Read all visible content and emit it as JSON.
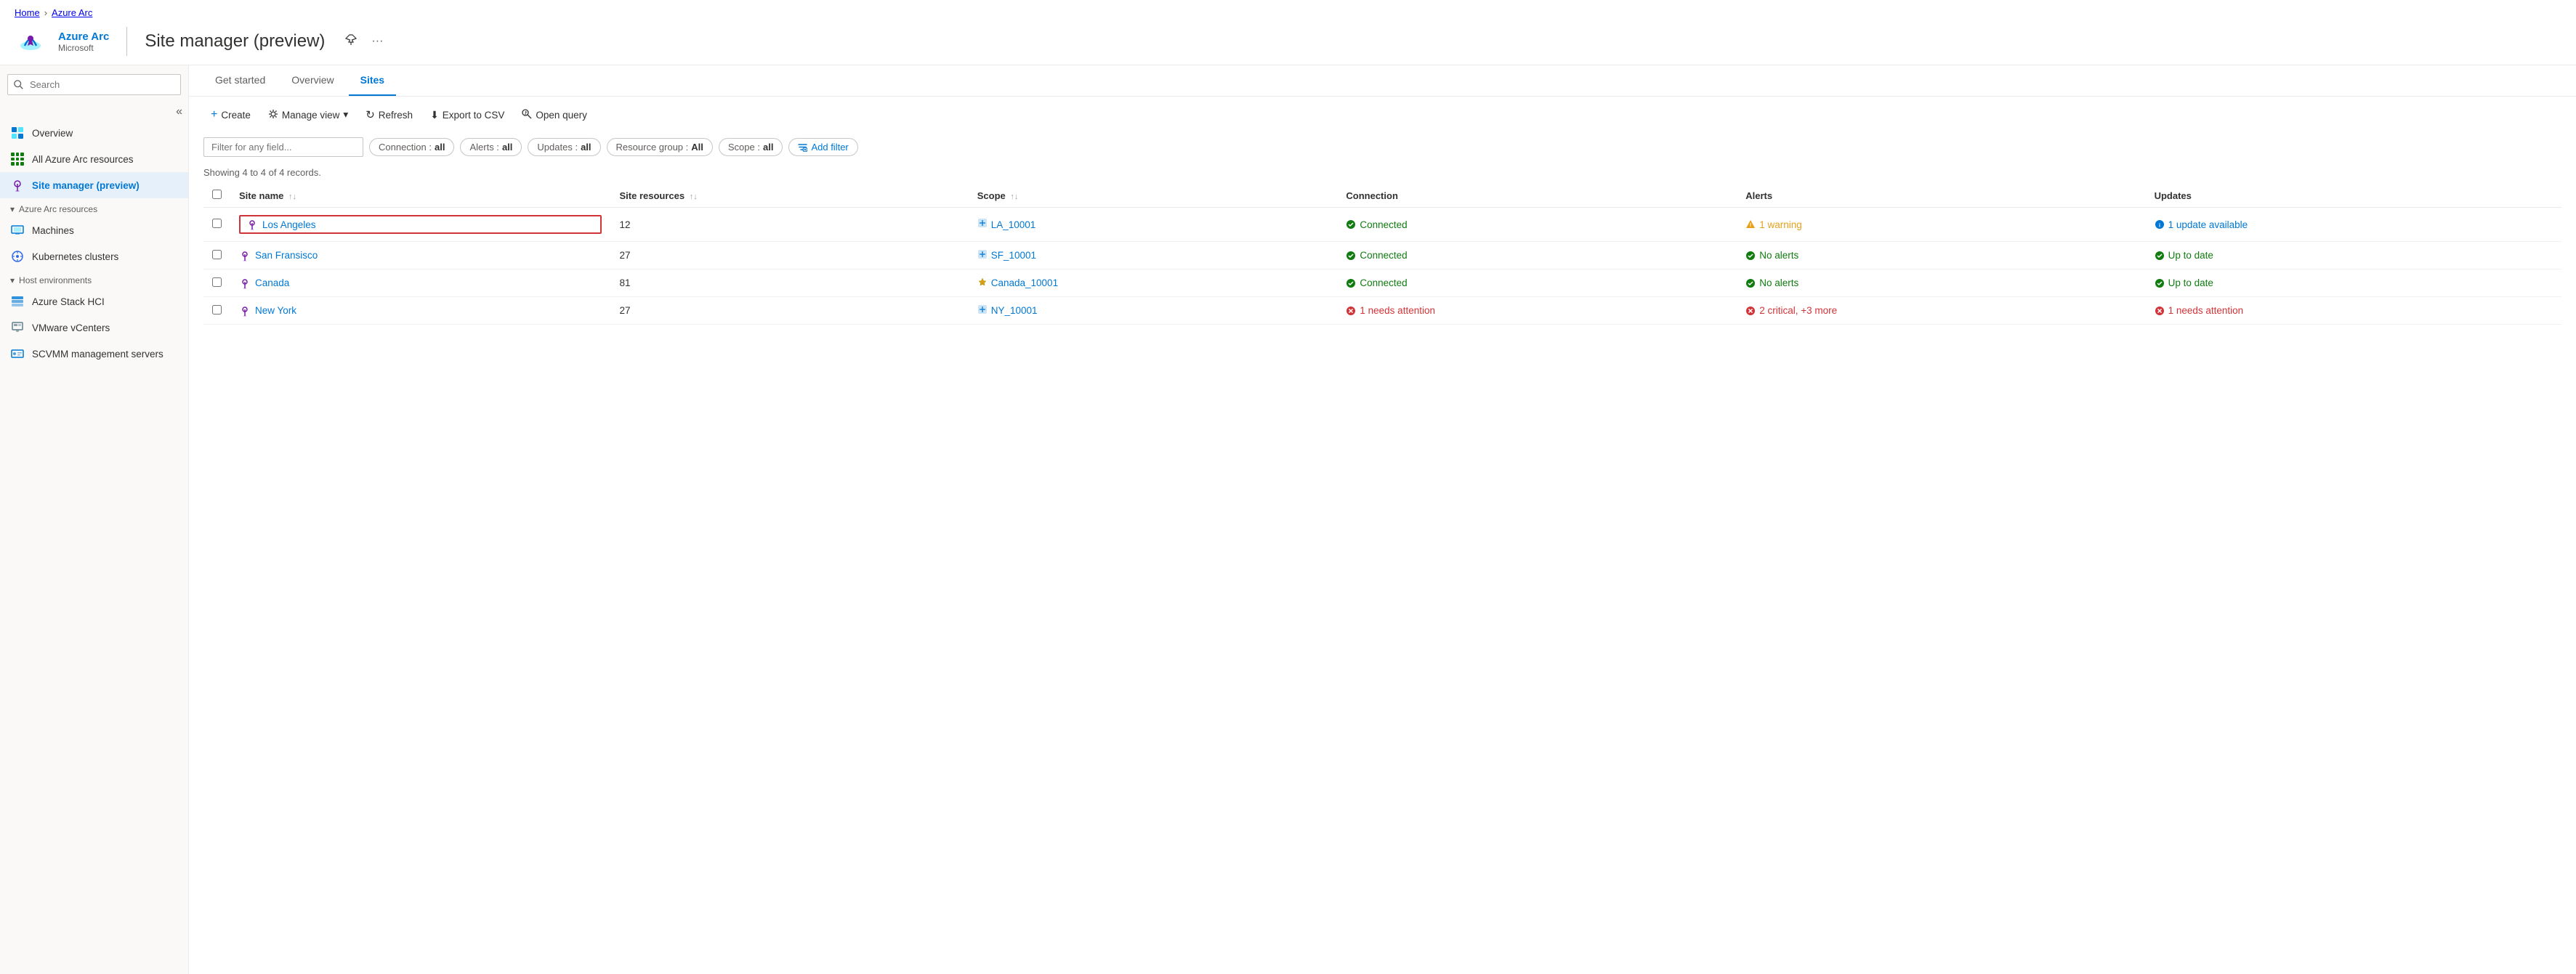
{
  "breadcrumb": {
    "items": [
      "Home",
      "Azure Arc"
    ]
  },
  "header": {
    "app_name": "Azure Arc",
    "subtitle": "Microsoft",
    "divider": true,
    "page_title": "Site manager (preview)",
    "pin_icon": "📌",
    "more_icon": "···"
  },
  "sidebar": {
    "search_placeholder": "Search",
    "collapse_icon": "«",
    "items": [
      {
        "id": "overview",
        "label": "Overview",
        "icon": "overview"
      },
      {
        "id": "all-arc",
        "label": "All Azure Arc resources",
        "icon": "grid"
      },
      {
        "id": "site-manager",
        "label": "Site manager (preview)",
        "icon": "pin",
        "active": true
      },
      {
        "id": "arc-resources-section",
        "label": "Azure Arc resources",
        "is_section": true
      },
      {
        "id": "machines",
        "label": "Machines",
        "icon": "machine"
      },
      {
        "id": "kubernetes",
        "label": "Kubernetes clusters",
        "icon": "k8s"
      },
      {
        "id": "host-section",
        "label": "Host environments",
        "is_section": true
      },
      {
        "id": "azure-stack",
        "label": "Azure Stack HCI",
        "icon": "stack"
      },
      {
        "id": "vmware",
        "label": "VMware vCenters",
        "icon": "vmware"
      },
      {
        "id": "scvmm",
        "label": "SCVMM management servers",
        "icon": "scvmm"
      }
    ]
  },
  "tabs": [
    {
      "id": "get-started",
      "label": "Get started",
      "active": false
    },
    {
      "id": "overview",
      "label": "Overview",
      "active": false
    },
    {
      "id": "sites",
      "label": "Sites",
      "active": true
    }
  ],
  "toolbar": {
    "create_label": "Create",
    "manage_view_label": "Manage view",
    "refresh_label": "Refresh",
    "export_csv_label": "Export to CSV",
    "open_query_label": "Open query"
  },
  "filters": {
    "placeholder": "Filter for any field...",
    "chips": [
      {
        "id": "connection",
        "label": "Connection",
        "value": "all"
      },
      {
        "id": "alerts",
        "label": "Alerts",
        "value": "all"
      },
      {
        "id": "updates",
        "label": "Updates",
        "value": "all"
      },
      {
        "id": "resource-group",
        "label": "Resource group",
        "value": "All"
      },
      {
        "id": "scope",
        "label": "Scope",
        "value": "all"
      }
    ],
    "add_filter_label": "Add filter",
    "add_filter_icon": "⊕"
  },
  "record_count": "Showing 4 to 4 of 4 records.",
  "table": {
    "columns": [
      {
        "id": "checkbox",
        "label": ""
      },
      {
        "id": "site-name",
        "label": "Site name",
        "sortable": true
      },
      {
        "id": "site-resources",
        "label": "Site resources",
        "sortable": true
      },
      {
        "id": "scope",
        "label": "Scope",
        "sortable": true
      },
      {
        "id": "connection",
        "label": "Connection",
        "sortable": false
      },
      {
        "id": "alerts",
        "label": "Alerts",
        "sortable": false
      },
      {
        "id": "updates",
        "label": "Updates",
        "sortable": false
      }
    ],
    "rows": [
      {
        "id": "los-angeles",
        "highlighted": true,
        "site_name": "Los Angeles",
        "site_resources": "12",
        "scope": "LA_10001",
        "scope_icon": "blue",
        "connection_status": "Connected",
        "connection_type": "connected",
        "alert_text": "1 warning",
        "alert_type": "warning",
        "update_text": "1 update available",
        "update_type": "info"
      },
      {
        "id": "san-fransisco",
        "highlighted": false,
        "site_name": "San Fransisco",
        "site_resources": "27",
        "scope": "SF_10001",
        "scope_icon": "blue",
        "connection_status": "Connected",
        "connection_type": "connected",
        "alert_text": "No alerts",
        "alert_type": "ok",
        "update_text": "Up to date",
        "update_type": "ok"
      },
      {
        "id": "canada",
        "highlighted": false,
        "site_name": "Canada",
        "site_resources": "81",
        "scope": "Canada_10001",
        "scope_icon": "gold",
        "connection_status": "Connected",
        "connection_type": "connected",
        "alert_text": "No alerts",
        "alert_type": "ok",
        "update_text": "Up to date",
        "update_type": "ok"
      },
      {
        "id": "new-york",
        "highlighted": false,
        "site_name": "New York",
        "site_resources": "27",
        "scope": "NY_10001",
        "scope_icon": "blue",
        "connection_status": "1 needs attention",
        "connection_type": "error",
        "alert_text": "2 critical, +3 more",
        "alert_type": "error",
        "update_text": "1 needs attention",
        "update_type": "error"
      }
    ]
  },
  "icons": {
    "check_green": "✅",
    "warning_yellow": "⚠",
    "error_red": "❌",
    "info_blue": "ℹ",
    "scope_blue": "🔷",
    "scope_gold": "🔑",
    "site_pin": "📍",
    "chevron_down": "▾",
    "sort_updown": "↑↓",
    "refresh": "↻",
    "export": "⬇",
    "query": "⚙"
  }
}
